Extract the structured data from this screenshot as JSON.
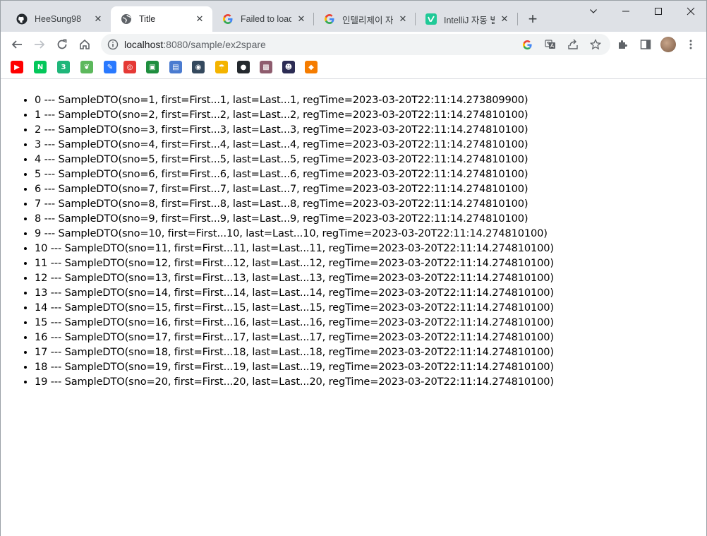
{
  "tabs": [
    {
      "title": "HeeSung98",
      "icon": "github-icon"
    },
    {
      "title": "Title",
      "icon": "globe-icon",
      "active": true
    },
    {
      "title": "Failed to load",
      "icon": "google-icon"
    },
    {
      "title": "인텔리제이 자",
      "icon": "google-icon"
    },
    {
      "title": "IntelliJ 자동 빌",
      "icon": "velog-icon"
    }
  ],
  "toolbar": {
    "url_host": "localhost",
    "url_rest": ":8080/sample/ex2spare"
  },
  "bookmarks": [
    {
      "name": "youtube-icon",
      "color": "#ff0000",
      "glyph": "▶"
    },
    {
      "name": "naver-icon",
      "color": "#03c75a",
      "glyph": "N"
    },
    {
      "name": "bookmark-green-icon",
      "color": "#1fb67a",
      "glyph": "3"
    },
    {
      "name": "leaf-icon",
      "color": "#5cb85c",
      "glyph": "❦"
    },
    {
      "name": "feather-icon",
      "color": "#2979ff",
      "glyph": "✎"
    },
    {
      "name": "lifebuoy-icon",
      "color": "#e53935",
      "glyph": "◎"
    },
    {
      "name": "classroom-icon",
      "color": "#1e8e3e",
      "glyph": "▣"
    },
    {
      "name": "dbdiagram-icon",
      "color": "#4a7bd0",
      "glyph": "▤"
    },
    {
      "name": "owl-icon",
      "color": "#34495e",
      "glyph": "◉"
    },
    {
      "name": "umbrella-icon",
      "color": "#f4b400",
      "glyph": "☂"
    },
    {
      "name": "github-bookmark-icon",
      "color": "#24292e",
      "glyph": "●"
    },
    {
      "name": "photo-icon",
      "color": "#8e5c6e",
      "glyph": "▩"
    },
    {
      "name": "character-icon",
      "color": "#2c2c54",
      "glyph": "☻"
    },
    {
      "name": "cube-icon",
      "color": "#f57c00",
      "glyph": "◆"
    }
  ],
  "items": [
    "0 --- SampleDTO(sno=1, first=First...1, last=Last...1, regTime=2023-03-20T22:11:14.273809900)",
    "1 --- SampleDTO(sno=2, first=First...2, last=Last...2, regTime=2023-03-20T22:11:14.274810100)",
    "2 --- SampleDTO(sno=3, first=First...3, last=Last...3, regTime=2023-03-20T22:11:14.274810100)",
    "3 --- SampleDTO(sno=4, first=First...4, last=Last...4, regTime=2023-03-20T22:11:14.274810100)",
    "4 --- SampleDTO(sno=5, first=First...5, last=Last...5, regTime=2023-03-20T22:11:14.274810100)",
    "5 --- SampleDTO(sno=6, first=First...6, last=Last...6, regTime=2023-03-20T22:11:14.274810100)",
    "6 --- SampleDTO(sno=7, first=First...7, last=Last...7, regTime=2023-03-20T22:11:14.274810100)",
    "7 --- SampleDTO(sno=8, first=First...8, last=Last...8, regTime=2023-03-20T22:11:14.274810100)",
    "8 --- SampleDTO(sno=9, first=First...9, last=Last...9, regTime=2023-03-20T22:11:14.274810100)",
    "9 --- SampleDTO(sno=10, first=First...10, last=Last...10, regTime=2023-03-20T22:11:14.274810100)",
    "10 --- SampleDTO(sno=11, first=First...11, last=Last...11, regTime=2023-03-20T22:11:14.274810100)",
    "11 --- SampleDTO(sno=12, first=First...12, last=Last...12, regTime=2023-03-20T22:11:14.274810100)",
    "12 --- SampleDTO(sno=13, first=First...13, last=Last...13, regTime=2023-03-20T22:11:14.274810100)",
    "13 --- SampleDTO(sno=14, first=First...14, last=Last...14, regTime=2023-03-20T22:11:14.274810100)",
    "14 --- SampleDTO(sno=15, first=First...15, last=Last...15, regTime=2023-03-20T22:11:14.274810100)",
    "15 --- SampleDTO(sno=16, first=First...16, last=Last...16, regTime=2023-03-20T22:11:14.274810100)",
    "16 --- SampleDTO(sno=17, first=First...17, last=Last...17, regTime=2023-03-20T22:11:14.274810100)",
    "17 --- SampleDTO(sno=18, first=First...18, last=Last...18, regTime=2023-03-20T22:11:14.274810100)",
    "18 --- SampleDTO(sno=19, first=First...19, last=Last...19, regTime=2023-03-20T22:11:14.274810100)",
    "19 --- SampleDTO(sno=20, first=First...20, last=Last...20, regTime=2023-03-20T22:11:14.274810100)"
  ]
}
